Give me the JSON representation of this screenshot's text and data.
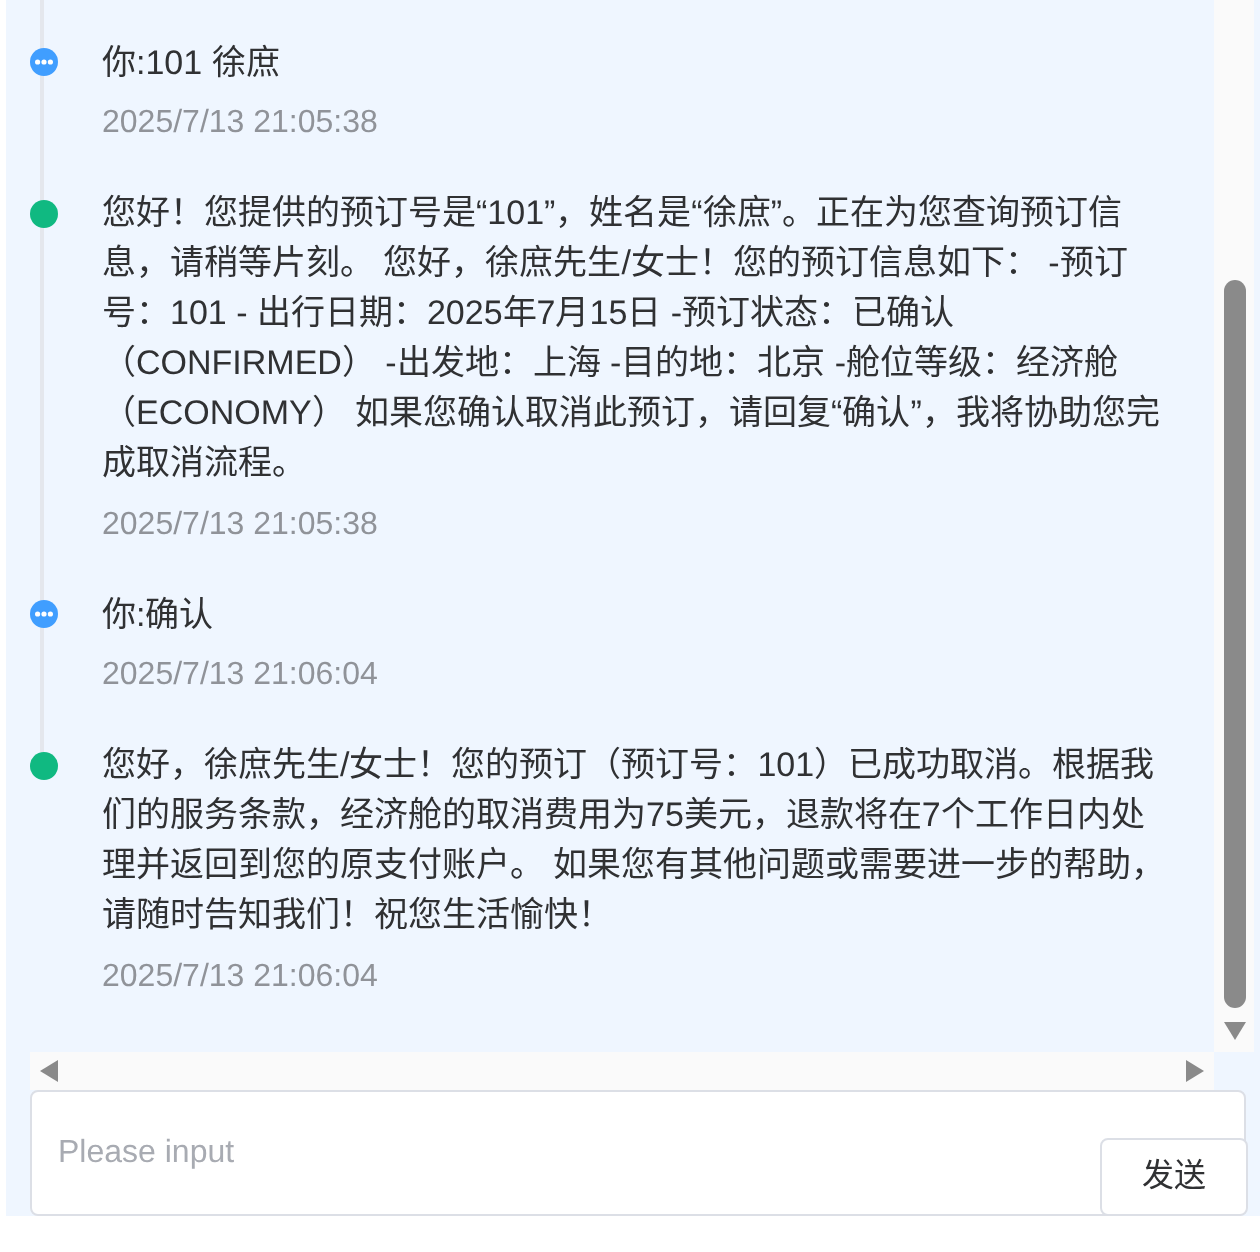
{
  "timeline": {
    "items": [
      {
        "kind": "user",
        "text": "你:101 徐庶",
        "time": "2025/7/13 21:05:38"
      },
      {
        "kind": "bot",
        "text": "您好！您提供的预订号是“101”，姓名是“徐庶”。正在为您查询预订信息，请稍等片刻。 您好，徐庶先生/女士！您的预订信息如下： -预订号：101 - 出行日期：2025年7月15日 -预订状态：已确认（CONFIRMED） -出发地：上海 -目的地：北京 -舱位等级：经济舱（ECONOMY） 如果您确认取消此预订，请回复“确认”，我将协助您完成取消流程。",
        "time": "2025/7/13 21:05:38"
      },
      {
        "kind": "user",
        "text": "你:确认",
        "time": "2025/7/13 21:06:04"
      },
      {
        "kind": "bot",
        "text": "您好，徐庶先生/女士！您的预订（预订号：101）已成功取消。根据我们的服务条款，经济舱的取消费用为75美元，退款将在7个工作日内处理并返回到您的原支付账户。 如果您有其他问题或需要进一步的帮助，请随时告知我们！祝您生活愉快！",
        "time": "2025/7/13 21:06:04"
      }
    ]
  },
  "input": {
    "placeholder": "Please input"
  },
  "send_button": {
    "label": "发送"
  }
}
